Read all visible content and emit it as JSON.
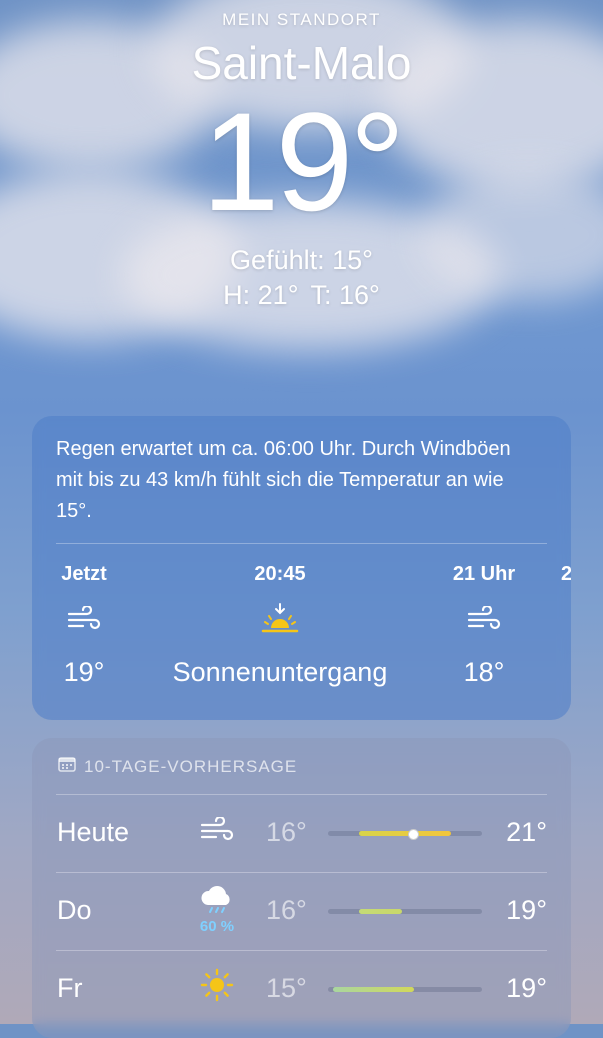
{
  "header": {
    "location_label": "MEIN STANDORT",
    "city": "Saint-Malo",
    "temperature": "19°",
    "feels_like": "Gefühlt: 15°",
    "high": "H: 21°",
    "low": "T: 16°"
  },
  "hourly": {
    "summary": "Regen erwartet um ca. 06:00 Uhr. Durch Windböen mit bis zu 43 km/h fühlt sich die Temperatur an wie 15°.",
    "items": [
      {
        "time": "Jetzt",
        "icon": "wind-icon",
        "value": "19°"
      },
      {
        "time": "20:45",
        "icon": "sunset-icon",
        "value": "Sonnenuntergang"
      },
      {
        "time": "21 Uhr",
        "icon": "wind-icon",
        "value": "18°"
      },
      {
        "time": "2",
        "icon": "",
        "value": ""
      }
    ]
  },
  "forecast": {
    "header_icon": "calendar-icon",
    "title": "10-TAGE-VORHERSAGE",
    "days": [
      {
        "day": "Heute",
        "icon": "wind-icon",
        "precip": "",
        "low": "16°",
        "high": "21°",
        "range_start": 0.2,
        "range_end": 0.8,
        "current": 0.55,
        "colors": [
          "#d8d44a",
          "#f2c53b"
        ]
      },
      {
        "day": "Do",
        "icon": "rain-cloud-icon",
        "precip": "60 %",
        "low": "16°",
        "high": "19°",
        "range_start": 0.2,
        "range_end": 0.48,
        "colors": [
          "#c4da76",
          "#c9d86a"
        ]
      },
      {
        "day": "Fr",
        "icon": "sun-icon",
        "precip": "",
        "low": "15°",
        "high": "19°",
        "range_start": 0.03,
        "range_end": 0.56,
        "colors": [
          "#a9d6a0",
          "#d2d85a"
        ]
      }
    ]
  },
  "colors": {
    "precip": "#7fd0ff",
    "sun": "#f5c518"
  }
}
